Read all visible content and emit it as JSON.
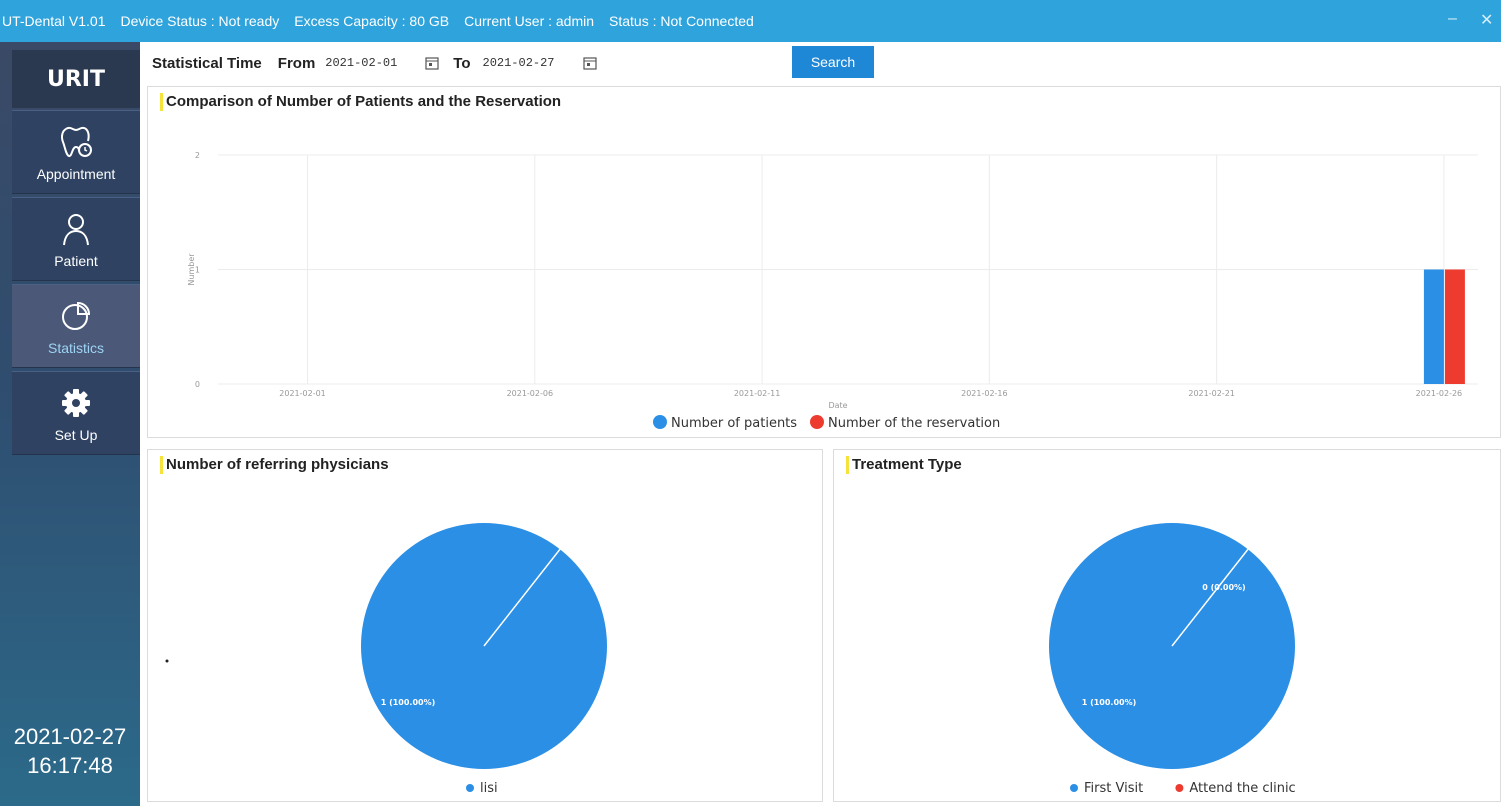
{
  "titlebar": {
    "app_name": "UT-Dental V1.01",
    "device_status": "Device Status : Not ready",
    "excess_capacity": "Excess Capacity : 80 GB",
    "current_user": "Current User : admin",
    "status": "Status : Not Connected",
    "minimize": "–",
    "close": "✕"
  },
  "sidebar": {
    "logo": "URIT",
    "items": [
      {
        "label": "Appointment",
        "icon": "tooth-icon"
      },
      {
        "label": "Patient",
        "icon": "user-icon"
      },
      {
        "label": "Statistics",
        "icon": "pie-chart-icon",
        "active": true
      },
      {
        "label": "Set Up",
        "icon": "gear-icon"
      }
    ],
    "date": "2021-02-27",
    "time": "16:17:48"
  },
  "toolbar": {
    "statistical_time": "Statistical Time",
    "from_label": "From",
    "from_value": "2021-02-01",
    "to_label": "To",
    "to_value": "2021-02-27",
    "search": "Search"
  },
  "panels": {
    "comparison_title": "Comparison of Number of Patients and the Reservation",
    "referring_title": "Number of referring physicians",
    "treatment_title": "Treatment Type"
  },
  "colors": {
    "blue": "#2b8fe5",
    "red": "#ee3b2f",
    "titlebar": "#2ea3dc",
    "accent": "#f5e23a"
  },
  "chart_data": [
    {
      "type": "bar",
      "title": "Comparison of Number of Patients and the Reservation",
      "xlabel": "Date",
      "ylabel": "Number",
      "ylim": [
        0,
        2
      ],
      "yticks": [
        "0",
        "1",
        "2"
      ],
      "xticks": [
        "2021-02-01",
        "2021-02-06",
        "2021-02-11",
        "2021-02-16",
        "2021-02-21",
        "2021-02-26"
      ],
      "grid": true,
      "legend": "bottom",
      "series": [
        {
          "name": "Number of patients",
          "x": [
            "2021-02-26"
          ],
          "values": [
            1
          ],
          "color": "#2b8fe5"
        },
        {
          "name": "Number of the reservation",
          "x": [
            "2021-02-26"
          ],
          "values": [
            1
          ],
          "color": "#ee3b2f"
        }
      ]
    },
    {
      "type": "pie",
      "title": "Number of referring physicians",
      "legend": "bottom",
      "slices": [
        {
          "name": "lisi",
          "value": 1,
          "label": "1 (100.00%)",
          "color": "#2b8fe5"
        }
      ]
    },
    {
      "type": "pie",
      "title": "Treatment Type",
      "legend": "bottom",
      "slices": [
        {
          "name": "First Visit",
          "value": 1,
          "label": "1 (100.00%)",
          "color": "#2b8fe5"
        },
        {
          "name": "Attend the clinic",
          "value": 0,
          "label": "0 (0.00%)",
          "color": "#ee3b2f"
        }
      ]
    }
  ]
}
